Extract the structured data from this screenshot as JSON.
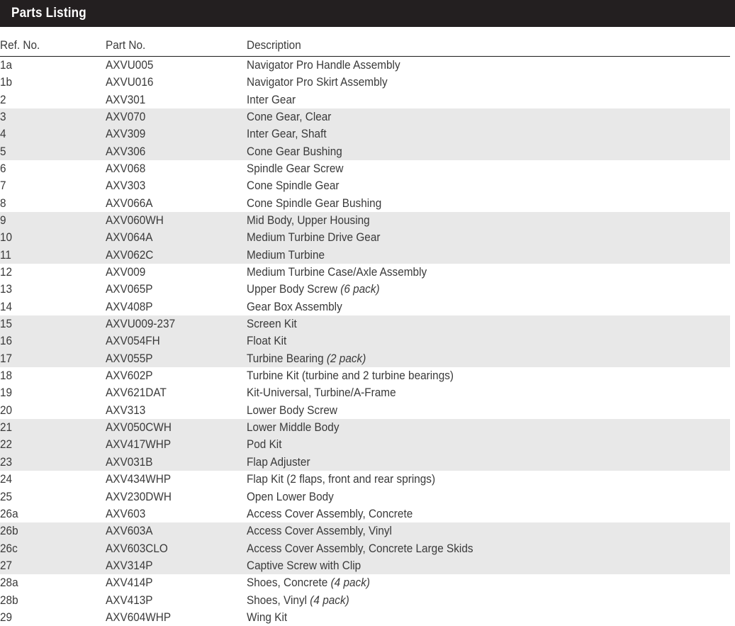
{
  "header": {
    "title": "Parts Listing",
    "background_color": "#231f20",
    "text_color": "#ffffff"
  },
  "table": {
    "columns": [
      "Ref. No.",
      "Part No.",
      "Description"
    ],
    "band_color": "#e8e8e8",
    "text_color": "#3a3a3a",
    "rows": [
      {
        "ref": "1a",
        "part": "AXVU005",
        "desc": "Navigator Pro Handle Assembly",
        "desc_italic": ""
      },
      {
        "ref": "1b",
        "part": "AXVU016",
        "desc": "Navigator Pro Skirt Assembly",
        "desc_italic": ""
      },
      {
        "ref": "2",
        "part": "AXV301",
        "desc": "Inter Gear",
        "desc_italic": ""
      },
      {
        "ref": "3",
        "part": "AXV070",
        "desc": "Cone Gear, Clear",
        "desc_italic": ""
      },
      {
        "ref": "4",
        "part": "AXV309",
        "desc": "Inter Gear, Shaft",
        "desc_italic": ""
      },
      {
        "ref": "5",
        "part": "AXV306",
        "desc": "Cone Gear Bushing",
        "desc_italic": ""
      },
      {
        "ref": "6",
        "part": "AXV068",
        "desc": "Spindle Gear Screw",
        "desc_italic": ""
      },
      {
        "ref": "7",
        "part": "AXV303",
        "desc": "Cone Spindle Gear",
        "desc_italic": ""
      },
      {
        "ref": "8",
        "part": "AXV066A",
        "desc": "Cone Spindle Gear Bushing",
        "desc_italic": ""
      },
      {
        "ref": "9",
        "part": "AXV060WH",
        "desc": "Mid Body, Upper Housing",
        "desc_italic": ""
      },
      {
        "ref": "10",
        "part": "AXV064A",
        "desc": "Medium Turbine Drive Gear",
        "desc_italic": ""
      },
      {
        "ref": "11",
        "part": "AXV062C",
        "desc": "Medium Turbine",
        "desc_italic": ""
      },
      {
        "ref": "12",
        "part": "AXV009",
        "desc": "Medium Turbine Case/Axle Assembly",
        "desc_italic": ""
      },
      {
        "ref": "13",
        "part": "AXV065P",
        "desc": "Upper Body Screw ",
        "desc_italic": "(6 pack)"
      },
      {
        "ref": "14",
        "part": "AXV408P",
        "desc": "Gear Box Assembly",
        "desc_italic": ""
      },
      {
        "ref": "15",
        "part": "AXVU009-237",
        "desc": "Screen Kit",
        "desc_italic": ""
      },
      {
        "ref": "16",
        "part": "AXV054FH",
        "desc": "Float Kit",
        "desc_italic": ""
      },
      {
        "ref": "17",
        "part": "AXV055P",
        "desc": "Turbine Bearing ",
        "desc_italic": "(2 pack)"
      },
      {
        "ref": "18",
        "part": "AXV602P",
        "desc": "Turbine Kit (turbine and 2 turbine bearings)",
        "desc_italic": ""
      },
      {
        "ref": "19",
        "part": "AXV621DAT",
        "desc": "Kit-Universal, Turbine/A-Frame",
        "desc_italic": ""
      },
      {
        "ref": "20",
        "part": "AXV313",
        "desc": "Lower Body Screw",
        "desc_italic": ""
      },
      {
        "ref": "21",
        "part": "AXV050CWH",
        "desc": "Lower Middle Body",
        "desc_italic": ""
      },
      {
        "ref": "22",
        "part": "AXV417WHP",
        "desc": "Pod Kit",
        "desc_italic": ""
      },
      {
        "ref": "23",
        "part": "AXV031B",
        "desc": "Flap Adjuster",
        "desc_italic": ""
      },
      {
        "ref": "24",
        "part": "AXV434WHP",
        "desc": "Flap Kit (2 flaps, front and rear springs)",
        "desc_italic": ""
      },
      {
        "ref": "25",
        "part": "AXV230DWH",
        "desc": "Open Lower Body",
        "desc_italic": ""
      },
      {
        "ref": "26a",
        "part": "AXV603",
        "desc": "Access Cover Assembly, Concrete",
        "desc_italic": ""
      },
      {
        "ref": "26b",
        "part": "AXV603A",
        "desc": "Access Cover Assembly, Vinyl",
        "desc_italic": ""
      },
      {
        "ref": "26c",
        "part": "AXV603CLO",
        "desc": "Access Cover Assembly, Concrete Large Skids",
        "desc_italic": ""
      },
      {
        "ref": "27",
        "part": "AXV314P",
        "desc": "Captive Screw with Clip",
        "desc_italic": ""
      },
      {
        "ref": "28a",
        "part": "AXV414P",
        "desc": "Shoes, Concrete ",
        "desc_italic": "(4 pack)"
      },
      {
        "ref": "28b",
        "part": "AXV413P",
        "desc": "Shoes, Vinyl ",
        "desc_italic": "(4 pack)"
      },
      {
        "ref": "29",
        "part": "AXV604WHP",
        "desc": "Wing Kit",
        "desc_italic": ""
      }
    ]
  }
}
